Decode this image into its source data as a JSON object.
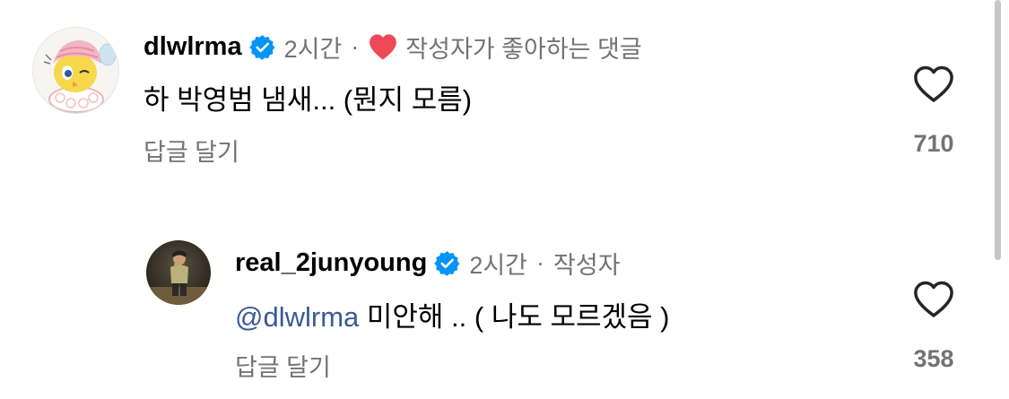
{
  "comments": [
    {
      "username": "dlwlrma",
      "time": "2시간",
      "separator": "·",
      "author_liked_label": "작성자가 좋아하는 댓글",
      "text": "하 박영범 냄새... (뭔지 모름)",
      "reply_label": "답글 달기",
      "like_count": "710",
      "avatar_icon": "cartoon-bird-avatar-icon",
      "verified_color": "#0095f6",
      "heart_color": "#ed4956"
    },
    {
      "username": "real_2junyoung",
      "time": "2시간",
      "separator": "·",
      "author_tag": "작성자",
      "mention": "@dlwlrma",
      "text": " 미안해 .. ( 나도 모르겠음 )",
      "reply_label": "답글 달기",
      "like_count": "358",
      "avatar_icon": "person-photo-avatar-icon",
      "verified_color": "#0095f6",
      "mention_color": "#3a5a95"
    }
  ]
}
